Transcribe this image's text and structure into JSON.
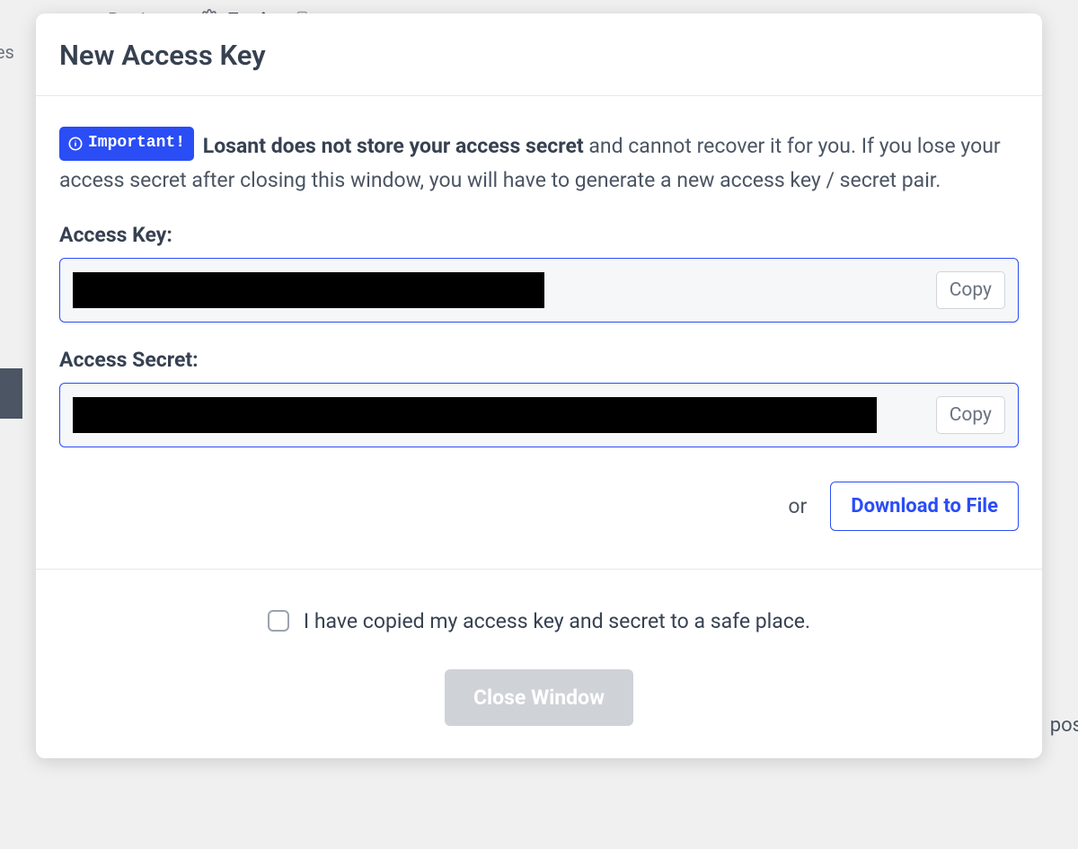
{
  "background": {
    "breadcrumb_parent": "Devices",
    "breadcrumb_current": "Engine",
    "sidebar_partial": "ies",
    "right_partial": "pos"
  },
  "modal": {
    "title": "New Access Key",
    "important_badge": "Important!",
    "important_bold": "Losant does not store your access secret",
    "important_rest": " and cannot recover it for you. If you lose your access secret after closing this window, you will have to generate a new access key / secret pair.",
    "access_key_label": "Access Key:",
    "access_secret_label": "Access Secret:",
    "copy_label": "Copy",
    "or_label": "or",
    "download_label": "Download to File",
    "confirm_label": "I have copied my access key and secret to a safe place.",
    "close_label": "Close Window"
  }
}
